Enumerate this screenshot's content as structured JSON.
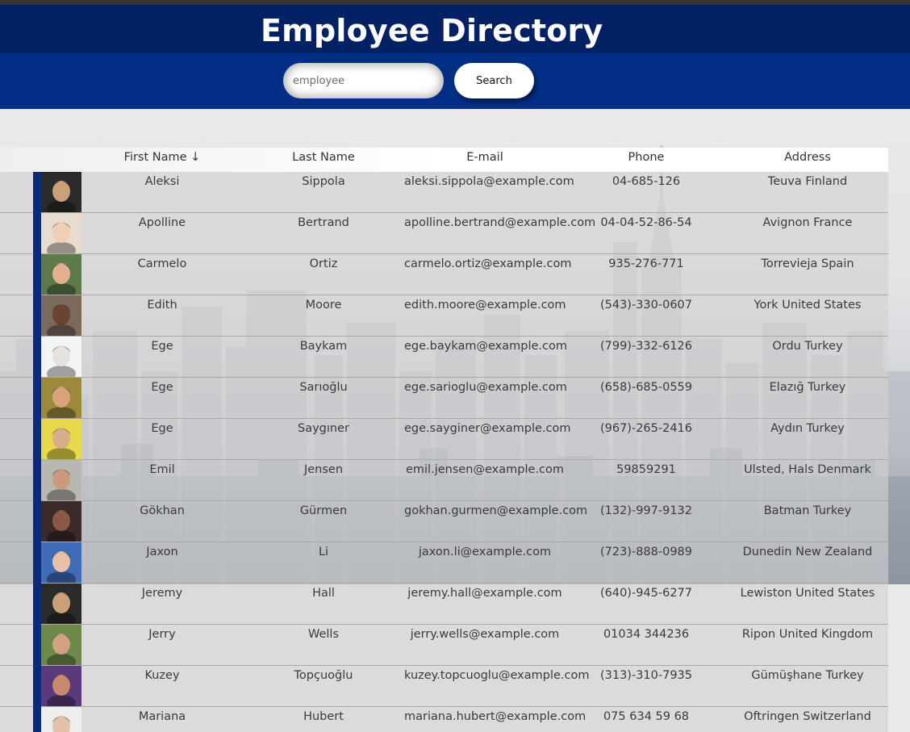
{
  "header": {
    "title": "Employee Directory"
  },
  "search": {
    "placeholder": "employee",
    "value": "",
    "button_label": "Search"
  },
  "table": {
    "columns": {
      "first_name": "First Name ↓",
      "last_name": "Last Name",
      "email": "E-mail",
      "phone": "Phone",
      "address": "Address"
    },
    "rows": [
      {
        "first": "Aleksi",
        "last": "Sippola",
        "email": "aleksi.sippola@example.com",
        "phone": "04-685-126",
        "address": "Teuva Finland",
        "avatar_skin": "#c9a07a",
        "avatar_bg": "#2a2a2a"
      },
      {
        "first": "Apolline",
        "last": "Bertrand",
        "email": "apolline.bertrand@example.com",
        "phone": "04-04-52-86-54",
        "address": "Avignon France",
        "avatar_skin": "#f0cfb5",
        "avatar_bg": "#e7dccf"
      },
      {
        "first": "Carmelo",
        "last": "Ortiz",
        "email": "carmelo.ortiz@example.com",
        "phone": "935-276-771",
        "address": "Torrevieja Spain",
        "avatar_skin": "#e2b08f",
        "avatar_bg": "#5d7a4a"
      },
      {
        "first": "Edith",
        "last": "Moore",
        "email": "edith.moore@example.com",
        "phone": "(543)-330-0607",
        "address": "York United States",
        "avatar_skin": "#6b4330",
        "avatar_bg": "#7b6a5c"
      },
      {
        "first": "Ege",
        "last": "Baykam",
        "email": "ege.baykam@example.com",
        "phone": "(799)-332-6126",
        "address": "Ordu Turkey",
        "avatar_skin": "#e6e2de",
        "avatar_bg": "#f4f4f4"
      },
      {
        "first": "Ege",
        "last": "Sarıoğlu",
        "email": "ege.sarioglu@example.com",
        "phone": "(658)-685-0559",
        "address": "Elazığ Turkey",
        "avatar_skin": "#d9a47c",
        "avatar_bg": "#9a8a3a"
      },
      {
        "first": "Ege",
        "last": "Saygıner",
        "email": "ege.sayginer@example.com",
        "phone": "(967)-265-2416",
        "address": "Aydın Turkey",
        "avatar_skin": "#d8ae8a",
        "avatar_bg": "#e7d94a"
      },
      {
        "first": "Emil",
        "last": "Jensen",
        "email": "emil.jensen@example.com",
        "phone": "59859291",
        "address": "Ulsted, Hals Denmark",
        "avatar_skin": "#c99a7c",
        "avatar_bg": "#b8b8b0"
      },
      {
        "first": "Gökhan",
        "last": "Gürmen",
        "email": "gokhan.gurmen@example.com",
        "phone": "(132)-997-9132",
        "address": "Batman Turkey",
        "avatar_skin": "#8a5a46",
        "avatar_bg": "#3a2a2a"
      },
      {
        "first": "Jaxon",
        "last": "Li",
        "email": "jaxon.li@example.com",
        "phone": "(723)-888-0989",
        "address": "Dunedin New Zealand",
        "avatar_skin": "#e7c0a8",
        "avatar_bg": "#3f6bb7"
      },
      {
        "first": "Jeremy",
        "last": "Hall",
        "email": "jeremy.hall@example.com",
        "phone": "(640)-945-6277",
        "address": "Lewiston United States",
        "avatar_skin": "#c9a07a",
        "avatar_bg": "#2a2a2a"
      },
      {
        "first": "Jerry",
        "last": "Wells",
        "email": "jerry.wells@example.com",
        "phone": "01034 344236",
        "address": "Ripon United Kingdom",
        "avatar_skin": "#d2a184",
        "avatar_bg": "#6d8a4a"
      },
      {
        "first": "Kuzey",
        "last": "Topçuoğlu",
        "email": "kuzey.topcuoglu@example.com",
        "phone": "(313)-310-7935",
        "address": "Gümüşhane Turkey",
        "avatar_skin": "#c88a6e",
        "avatar_bg": "#5a3a7a"
      },
      {
        "first": "Mariana",
        "last": "Hubert",
        "email": "mariana.hubert@example.com",
        "phone": "075 634 59 68",
        "address": "Oftringen Switzerland",
        "avatar_skin": "#e3c0a8",
        "avatar_bg": "#eeeeee"
      }
    ]
  },
  "colors": {
    "title_bar": "#022064",
    "search_bar": "#032e86",
    "row_accent": "#0a2b7a"
  }
}
